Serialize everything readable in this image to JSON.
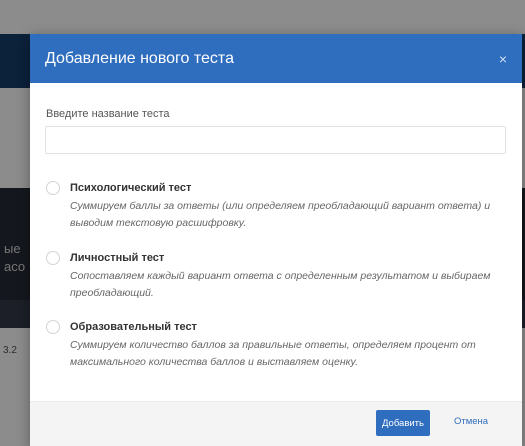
{
  "background": {
    "fragment_1": "ые",
    "fragment_2": "асо",
    "fragment_3": "3.2"
  },
  "modal": {
    "title": "Добавление нового теста",
    "close_glyph": "×",
    "name_label": "Введите название теста",
    "name_value": "",
    "name_placeholder": "",
    "options": [
      {
        "title": "Психологический тест",
        "description": "Суммируем баллы за ответы (или определяем преобладающий вариант ответа) и выводим текстовую расшифровку.",
        "selected": false
      },
      {
        "title": "Личностный тест",
        "description": "Сопоставляем каждый вариант ответа с определенным результатом и выбираем преобладающий.",
        "selected": false
      },
      {
        "title": "Образовательный тест",
        "description": "Суммируем количество баллов за правильные ответы, определяем процент от максимального количества баллов и выставляем оценку.",
        "selected": false
      }
    ],
    "footer": {
      "add_label": "Добавить",
      "cancel_label": "Отмена"
    }
  },
  "colors": {
    "accent": "#2f6dbe",
    "navbar": "#173c6b",
    "footer_bg": "#f4f4f4"
  }
}
